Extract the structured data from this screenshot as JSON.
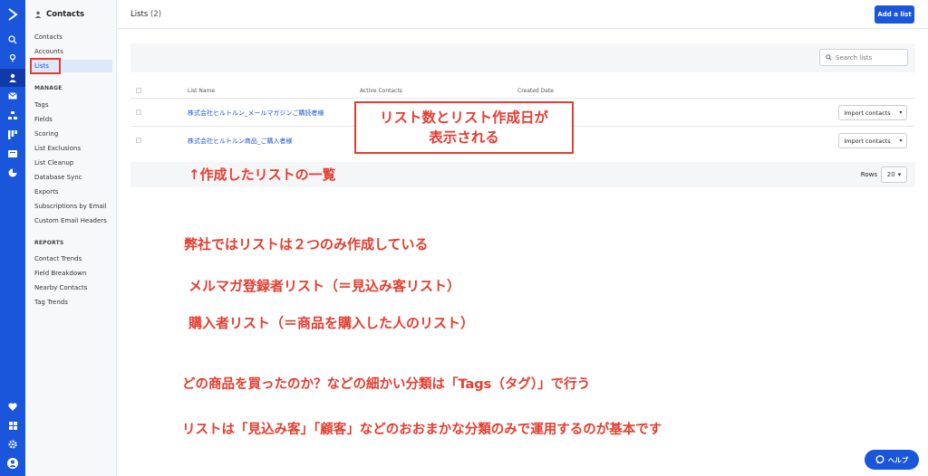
{
  "subnav": {
    "title": "Contacts",
    "items": [
      "Contacts",
      "Accounts",
      "Lists"
    ],
    "manage_heading": "MANAGE",
    "manage": [
      "Tags",
      "Fields",
      "Scoring",
      "List Exclusions",
      "List Cleanup",
      "Database Sync",
      "Exports",
      "Subscriptions by Email",
      "Custom Email Headers"
    ],
    "reports_heading": "REPORTS",
    "reports": [
      "Contact Trends",
      "Field Breakdown",
      "Nearby Contacts",
      "Tag Trends"
    ]
  },
  "header": {
    "title": "Lists",
    "count": "(2)",
    "add_button": "Add a list"
  },
  "search": {
    "placeholder": "Search lists"
  },
  "table": {
    "columns": [
      "List Name",
      "Active Contacts",
      "Created Date"
    ],
    "rows": [
      {
        "name": "株式会社ヒルトルン_メールマガジンご購読者様",
        "action": "Import contacts"
      },
      {
        "name": "株式会社ヒルトルン商品_ご購入者様",
        "action": "Import contacts"
      }
    ],
    "rows_label": "Rows",
    "rows_value": "20"
  },
  "annotations": {
    "callout_line1": "リスト数とリスト作成日が",
    "callout_line2": "表示される",
    "arrow_note": "↑作成したリストの一覧",
    "note1": "弊社ではリストは２つのみ作成している",
    "note2": "メルマガ登録者リスト（＝見込み客リスト）",
    "note3": "購入者リスト（＝商品を購入した人のリスト）",
    "note4": "どの商品を買ったのか？などの細かい分類は「Tags（タグ）」で行う",
    "note5": "リストは「見込み客」「顧客」などのおおまかな分類のみで運用するのが基本です"
  },
  "help": {
    "label": "ヘルプ"
  },
  "colors": {
    "brand": "#1a56db",
    "annotation": "#e63c2f"
  }
}
